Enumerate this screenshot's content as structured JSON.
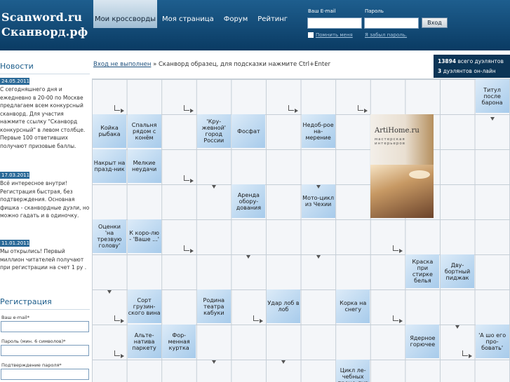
{
  "site": {
    "logo_line1": "Scanword.ru",
    "logo_line2": "Сканворд.рф"
  },
  "nav": {
    "items": [
      "Мои кроссворды",
      "Моя страница",
      "Форум",
      "Рейтинг"
    ]
  },
  "login": {
    "email_label": "Ваш E-mail",
    "password_label": "Пароль",
    "submit_label": "Вход",
    "remember_label": "Помнить меня",
    "forgot_label": "Я забыл пароль."
  },
  "sidebar": {
    "news_title": "Новости",
    "news": [
      {
        "date": "24.05.2011",
        "text": "С сегодняшнего дня и ежедневно в 20-00 по Москве предлагаем всем конкурсный сканворд. Для участия нажмите ссылку \"Сканворд конкурсный\" в левом столбце. Первые 100 ответивших получают призовые баллы."
      },
      {
        "date": "17.03.2011",
        "text": "Всё интересное внутри! Регистрация быстрая, без подтверждения. Основная фишка - сканвордные дуэли, но можно гадать и в одиночку."
      },
      {
        "date": "11.01.2011",
        "text": "Мы открылись! Первый миллион читателей получают при регистрации на счет 1 ру ."
      }
    ],
    "registration": {
      "title": "Регистрация",
      "email_label": "Ваш e-mail*",
      "password_label": "Пароль (мин. 6 символов)*",
      "confirm_label": "Подтверждение пароля*"
    }
  },
  "breadcrumb": {
    "link": "Вход не выполнен",
    "separator": " » ",
    "text": "Сканворд образец, для подсказки нажмите Ctrl+Enter"
  },
  "stats": {
    "duelists_count": "13894",
    "duelists_label": " всего дуэлянтов",
    "online_count": "3",
    "online_label": " дуэлянтов он-лайн"
  },
  "ad": {
    "logo": "ArtiHome.ru",
    "tagline": "мастерская интерьеров"
  },
  "clues": [
    "Титул после барона",
    "Койка рыбака",
    "Спальня рядом с конём",
    "'Кру-жевной' город России",
    "Фосфат",
    "Недоб-рое на-мерение",
    "Накрыт на празд-ник",
    "Мелкие неудачи",
    "Аренда обору-дования",
    "Мото-цикл из Чехии",
    "Оценки 'на трезвую голову'",
    "К коро-лю - 'Ваше ...'",
    "Краска при стирке белья",
    "Дву-бортный пиджак",
    "Сорт грузин-ского вина",
    "Родина театра кабуки",
    "Удар лоб в лоб",
    "Корка на снегу",
    "Альте-натива паркету",
    "Фор-менная куртка",
    "Ядерное горючее",
    "'А шо его про-бовать'",
    "Цикл ле-чебных проце-дур"
  ]
}
